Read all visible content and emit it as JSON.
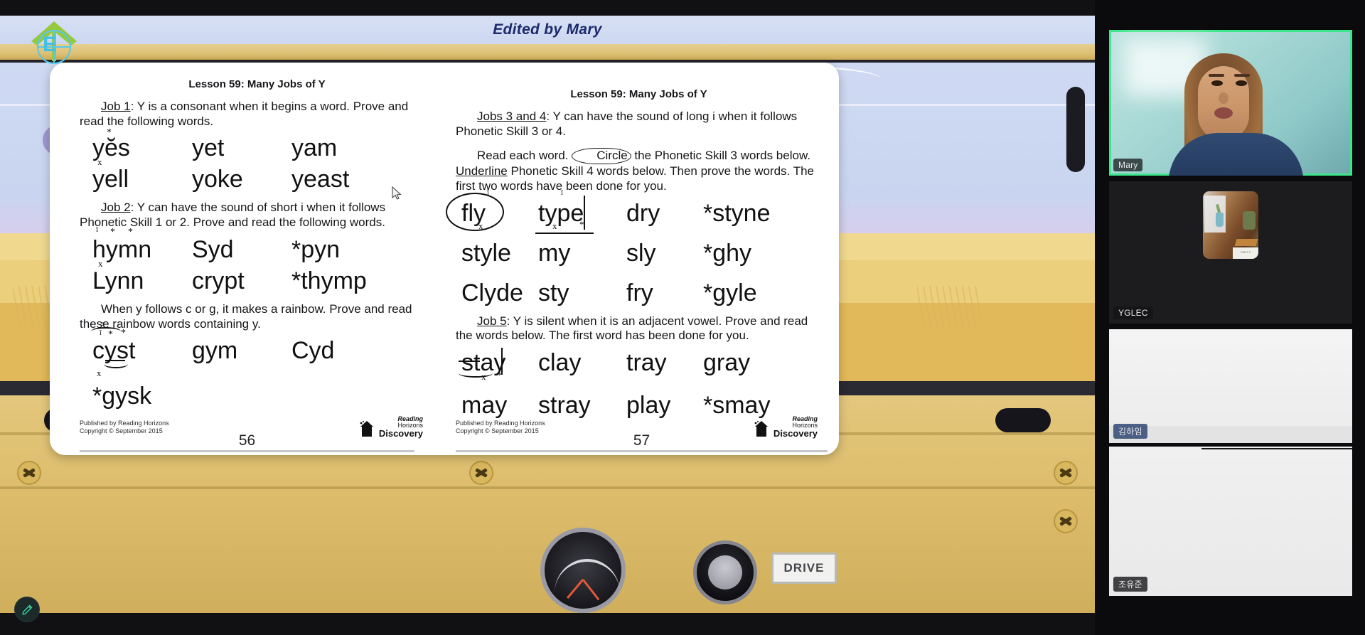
{
  "meeting": {
    "header_title": "Edited by Mary",
    "annotate_icon": "pencil-icon",
    "logo_letter": "E"
  },
  "worksheet": {
    "left_page": {
      "title": "Lesson 59: Many Jobs of Y",
      "job1": {
        "label": "Job 1",
        "text": ": Y is a consonant when it begins a word. Prove and read the following words.",
        "words": [
          "yĕs",
          "yet",
          "yam",
          "yell",
          "yoke",
          "yeast"
        ]
      },
      "job2": {
        "label": "Job 2",
        "text": ": Y can have the sound of short i when it follows Phonetic Skill 1 or 2. Prove and read the following words.",
        "words": [
          "hymn",
          "Syd",
          "*pyn",
          "Lynn",
          "crypt",
          "*thymp"
        ]
      },
      "rainbow": {
        "text": "When y follows c or g, it makes a rainbow. Prove and read these rainbow words containing y.",
        "words": [
          "cyst",
          "gym",
          "Cyd",
          "*gysk"
        ]
      },
      "published": "Published by Reading Horizons",
      "copyright": "Copyright © September 2015",
      "page_number": "56",
      "logo_line1": "Reading",
      "logo_line2": "Horizons",
      "logo_line3": "Discovery"
    },
    "right_page": {
      "title": "Lesson 59: Many Jobs of Y",
      "jobs34": {
        "label": "Jobs 3 and 4",
        "text": ": Y can have the sound of long i when it follows Phonetic Skill 3 or 4.",
        "instruction_a": "Read each word. ",
        "instruction_circle": "Circle",
        "instruction_b": " the Phonetic Skill 3 words below. ",
        "instruction_underline": "Underline",
        "instruction_c": " Phonetic Skill 4 words below. Then prove the words. The first two words have been done for you.",
        "words": [
          "fly",
          "type",
          "dry",
          "*styne",
          "style",
          "my",
          "sly",
          "*ghy",
          "Clyde",
          "sty",
          "fry",
          "*gyle"
        ]
      },
      "job5": {
        "label": "Job 5",
        "text": ": Y is silent when it is an adjacent vowel. Prove and read the words below. The first word has been done for you.",
        "words": [
          "stay",
          "clay",
          "tray",
          "gray",
          "may",
          "stray",
          "play",
          "*smay"
        ]
      },
      "published": "Published by Reading Horizons",
      "copyright": "Copyright © September 2015",
      "page_number": "57",
      "logo_line1": "Reading",
      "logo_line2": "Horizons",
      "logo_line3": "Discovery"
    }
  },
  "participants": [
    {
      "name": "Mary",
      "active_speaker": true
    },
    {
      "name": "YGLEC",
      "active_speaker": false
    },
    {
      "name": "김하임",
      "active_speaker": false
    },
    {
      "name": "조유준",
      "active_speaker": false
    }
  ],
  "colors": {
    "active_speaker_border": "#3ce68a",
    "header_text": "#1c2a6b",
    "header_background": "#ccd7f0",
    "jeep_gold": "#dcc074",
    "annotate_accent": "#35d39a"
  },
  "vehicle": {
    "plate_text": "DRIVE"
  }
}
